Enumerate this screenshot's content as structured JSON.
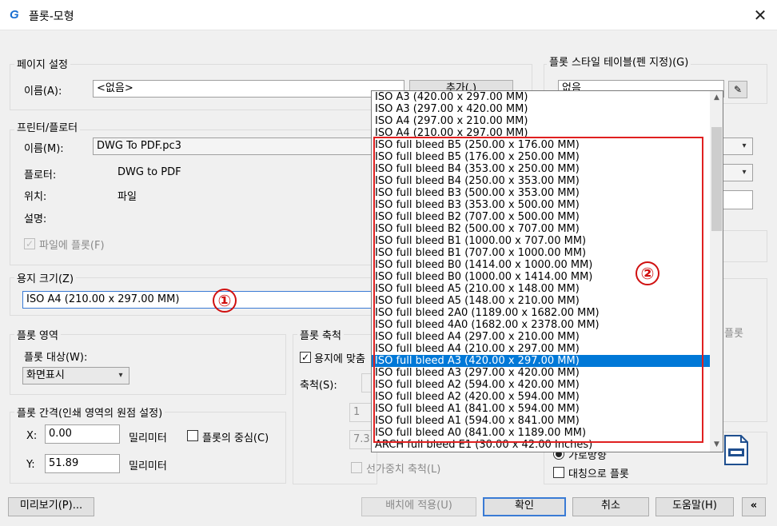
{
  "window": {
    "title": "플롯-모형",
    "app_icon": "G"
  },
  "page_setup": {
    "group_label": "페이지 설정",
    "name_label": "이름(A):",
    "name_value": "<없음>",
    "add_button": "추가(.)"
  },
  "printer": {
    "group_label": "프린터/플로터",
    "name_label": "이름(M):",
    "name_value": "DWG To PDF.pc3",
    "plotter_label": "플로터:",
    "plotter_value": "DWG to PDF",
    "location_label": "위치:",
    "location_value": "파일",
    "description_label": "설명:",
    "plot_to_file_label": "파일에 플롯(F)"
  },
  "paper_size": {
    "group_label": "용지 크기(Z)",
    "value": "ISO A4 (210.00 x 297.00 MM)",
    "marker_1": "①"
  },
  "plot_area": {
    "group_label": "플롯 영역",
    "what_label": "플롯 대상(W):",
    "what_value": "화면표시"
  },
  "plot_offset": {
    "group_label": "플롯 간격(인쇄 영역의 원점 설정)",
    "x_label": "X:",
    "x_value": "0.00",
    "x_unit": "밀리미터",
    "y_label": "Y:",
    "y_value": "51.89",
    "y_unit": "밀리미터",
    "center_label": "플롯의 중심(C)"
  },
  "plot_scale": {
    "group_label": "플롯 축척",
    "fit_label": "용지에 맞춤",
    "scale_label": "축척(S):",
    "field1_value": "1",
    "field2_value": "7.3",
    "lineweight_label": "선가중치 축척(L)"
  },
  "plot_style_table": {
    "group_label": "플롯 스타일 테이블(펜 지정)(G)",
    "value": "없음"
  },
  "options": {
    "plot_partial_label": "플롯",
    "landscape_label": "가로방향",
    "upside_down_label": "대칭으로 플롯"
  },
  "dropdown": {
    "items": [
      "ISO A3 (420.00 x 297.00 MM)",
      "ISO A3 (297.00 x 420.00 MM)",
      "ISO A4 (297.00 x 210.00 MM)",
      "ISO A4 (210.00 x 297.00 MM)",
      "ISO full bleed B5 (250.00 x 176.00 MM)",
      "ISO full bleed B5 (176.00 x 250.00 MM)",
      "ISO full bleed B4 (353.00 x 250.00 MM)",
      "ISO full bleed B4 (250.00 x 353.00 MM)",
      "ISO full bleed B3 (500.00 x 353.00 MM)",
      "ISO full bleed B3 (353.00 x 500.00 MM)",
      "ISO full bleed B2 (707.00 x 500.00 MM)",
      "ISO full bleed B2 (500.00 x 707.00 MM)",
      "ISO full bleed B1 (1000.00 x 707.00 MM)",
      "ISO full bleed B1 (707.00 x 1000.00 MM)",
      "ISO full bleed B0 (1414.00 x 1000.00 MM)",
      "ISO full bleed B0 (1000.00 x 1414.00 MM)",
      "ISO full bleed A5 (210.00 x 148.00 MM)",
      "ISO full bleed A5 (148.00 x 210.00 MM)",
      "ISO full bleed 2A0 (1189.00 x 1682.00 MM)",
      "ISO full bleed 4A0 (1682.00 x 2378.00 MM)",
      "ISO full bleed A4 (297.00 x 210.00 MM)",
      "ISO full bleed A4 (210.00 x 297.00 MM)",
      "ISO full bleed A3 (420.00 x 297.00 MM)",
      "ISO full bleed A3 (297.00 x 420.00 MM)",
      "ISO full bleed A2 (594.00 x 420.00 MM)",
      "ISO full bleed A2 (420.00 x 594.00 MM)",
      "ISO full bleed A1 (841.00 x 594.00 MM)",
      "ISO full bleed A1 (594.00 x 841.00 MM)",
      "ISO full bleed A0 (841.00 x 1189.00 MM)",
      "ARCH full bleed E1 (30.00 x 42.00 Inches)"
    ],
    "selected_index": 22,
    "marker_2": "②"
  },
  "buttons": {
    "preview": "미리보기(P)...",
    "apply_to_layout": "배치에 적용(U)",
    "ok": "확인",
    "cancel": "취소",
    "help": "도움말(H)",
    "collapse": "«"
  },
  "colors": {
    "accent": "#0078d7",
    "highlight_box": "#e02020"
  }
}
